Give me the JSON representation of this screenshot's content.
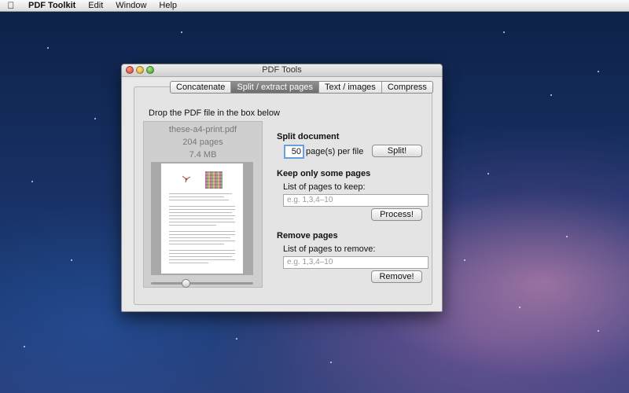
{
  "menubar": {
    "app_name": "PDF Toolkit",
    "items": [
      "Edit",
      "Window",
      "Help"
    ]
  },
  "window": {
    "title": "PDF Tools"
  },
  "tabs": [
    {
      "label": "Concatenate",
      "active": false
    },
    {
      "label": "Split / extract pages",
      "active": true
    },
    {
      "label": "Text / images",
      "active": false
    },
    {
      "label": "Compress",
      "active": false
    }
  ],
  "drop": {
    "label": "Drop the PDF file in the box below",
    "file_name": "these-a4-print.pdf",
    "pages": "204 pages",
    "size": "7.4 MB"
  },
  "split": {
    "heading": "Split document",
    "pages_per_file_value": "50",
    "pages_per_file_label": "page(s) per file",
    "button": "Split!"
  },
  "keep": {
    "heading": "Keep only some pages",
    "field_label": "List of pages to keep:",
    "placeholder": "e.g. 1,3,4–10",
    "button": "Process!"
  },
  "remove": {
    "heading": "Remove pages",
    "field_label": "List of pages to remove:",
    "placeholder": "e.g. 1,3,4–10",
    "button": "Remove!"
  },
  "colors": {
    "focus_ring": "#6a9ee0",
    "active_tab": "#7a7a7a"
  }
}
